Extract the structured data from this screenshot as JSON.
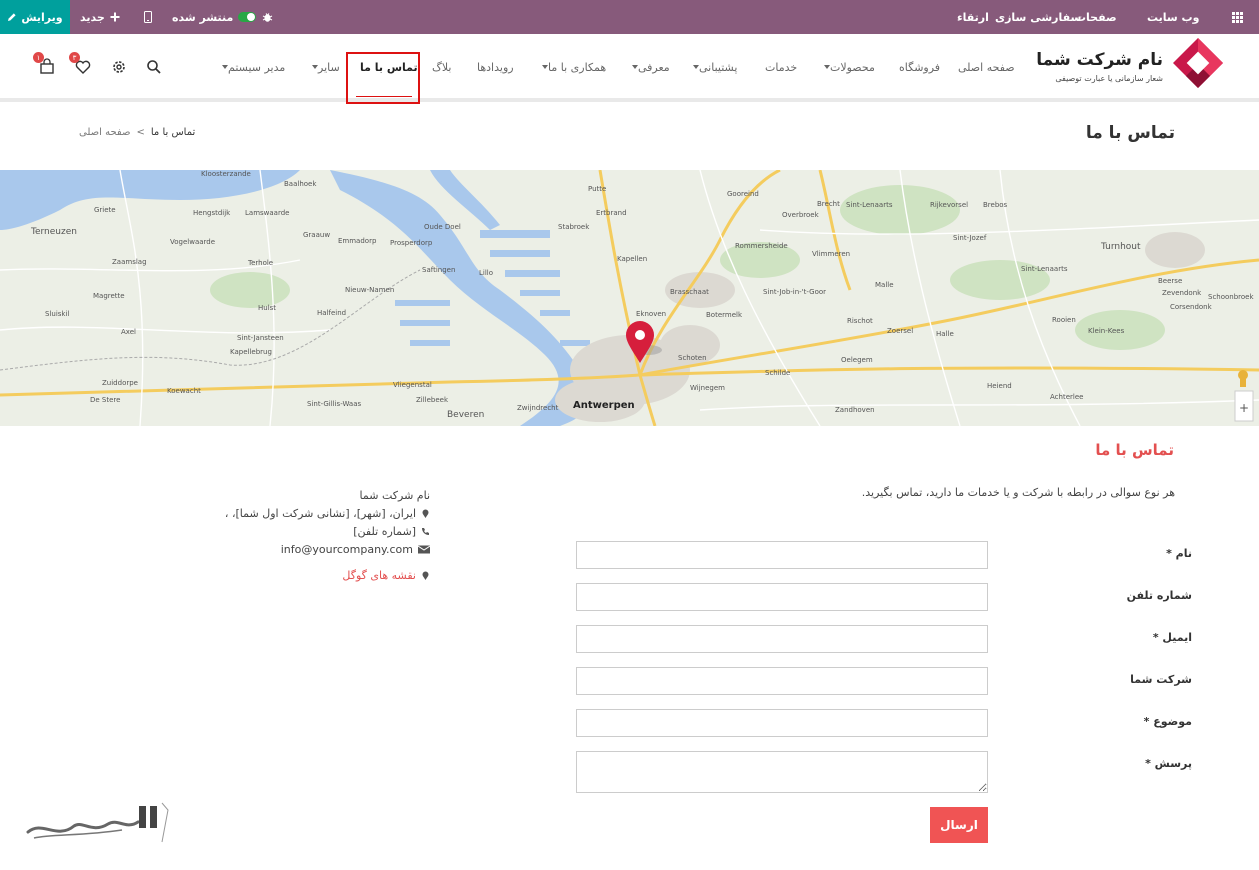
{
  "admin_bar": {
    "edit_label": "ویرایش",
    "new_label": "جدید",
    "published_label": "منتشر شده",
    "site_title": "وب سایت",
    "menu": [
      "صفحات",
      "سفارشی سازی",
      "ارتقاء"
    ],
    "colors": {
      "bar": "#875a7b",
      "edit": "#00a09d"
    }
  },
  "logo": {
    "name": "نام شرکت شما",
    "slogan": "شعار سازمانی یا عبارت توصیفی"
  },
  "nav": {
    "items": [
      {
        "label": "صفحه اصلی",
        "dropdown": false
      },
      {
        "label": "فروشگاه",
        "dropdown": false
      },
      {
        "label": "محصولات",
        "dropdown": true
      },
      {
        "label": "خدمات",
        "dropdown": false
      },
      {
        "label": "پشتیبانی",
        "dropdown": true
      },
      {
        "label": "معرفی",
        "dropdown": true
      },
      {
        "label": "همکاری با ما",
        "dropdown": true
      },
      {
        "label": "رویدادها",
        "dropdown": false
      },
      {
        "label": "بلاگ",
        "dropdown": false
      },
      {
        "label": "تماس با ما",
        "dropdown": false,
        "active": true
      },
      {
        "label": "سایر",
        "dropdown": true
      },
      {
        "label": "مدیر سیستم",
        "dropdown": true
      }
    ],
    "wishlist_count": "۳",
    "cart_count": "۱",
    "icons": [
      "search-icon",
      "gear-icon",
      "heart-icon",
      "cart-icon"
    ]
  },
  "page": {
    "title": "تماس با ما",
    "breadcrumb": [
      "صفحه اصلی",
      "تماس با ما"
    ]
  },
  "map": {
    "places": [
      "Kloosterzande",
      "Baalhoek",
      "Griete",
      "Hengstdijk",
      "Lamswaarde",
      "Graauw",
      "Emmadorp",
      "Prosperdorp",
      "Oude Doel",
      "Putte",
      "Ertbrand",
      "Stabroek",
      "Gooreind",
      "Overbroek",
      "Brecht",
      "Sint-Lenaarts",
      "Rijkevorsel",
      "Brebos",
      "Terneuzen",
      "Vogelwaarde",
      "Zaamslag",
      "Terhole",
      "Saftingen",
      "Lillo",
      "Kapellen",
      "Rommersheide",
      "Sint-Job-in-'t-Goor",
      "Vlimmeren",
      "Turnhout",
      "Sluiskil",
      "Magrette",
      "Nieuw-Namen",
      "Hulst",
      "Brasschaat",
      "Botermelk",
      "Malle",
      "Beerse",
      "Zevendonk",
      "Schoonbroek",
      "Corsendonk",
      "Axel",
      "Sint-Jansteen",
      "Kapellebrug",
      "Halfeind",
      "Schoten",
      "Rischot",
      "Zoersel",
      "Rooien",
      "Klein-Kees",
      "Zuiddorpe",
      "Koewacht",
      "Vliegenstal",
      "Schilde",
      "Oelegem",
      "Heiend",
      "Achterlee",
      "De Stere",
      "Sint-Gillis-Waas",
      "Zillebeek",
      "Beveren",
      "Zwijndrecht",
      "Antwerpen",
      "Wijnegem",
      "Zandhoven",
      "Halle",
      "Sint-Jozef",
      "Sint-Lenaarts",
      "Eknoven"
    ],
    "city": "Antwerpen"
  },
  "contact": {
    "section_title": "تماس با ما",
    "intro": "هر نوع سوالی در رابطه با شرکت و یا خدمات ما دارید، تماس بگیرید.",
    "company_name": "نام شرکت شما",
    "address": "ایران، [شهر]، [نشانی شرکت اول شما]، ،",
    "phone": "[شماره تلفن]",
    "email": "info@yourcompany.com",
    "maps_link": "نقشه های گوگل",
    "fields": [
      {
        "label": "نام *",
        "type": "text",
        "value": ""
      },
      {
        "label": "شماره تلفن",
        "type": "text",
        "value": ""
      },
      {
        "label": "ایمیل *",
        "type": "text",
        "value": ""
      },
      {
        "label": "شرکت شما",
        "type": "text",
        "value": ""
      },
      {
        "label": "موضوع *",
        "type": "text",
        "value": ""
      },
      {
        "label": "پرسش *",
        "type": "textarea",
        "value": ""
      }
    ],
    "submit_label": "ارسال",
    "accent": "#e35050"
  }
}
